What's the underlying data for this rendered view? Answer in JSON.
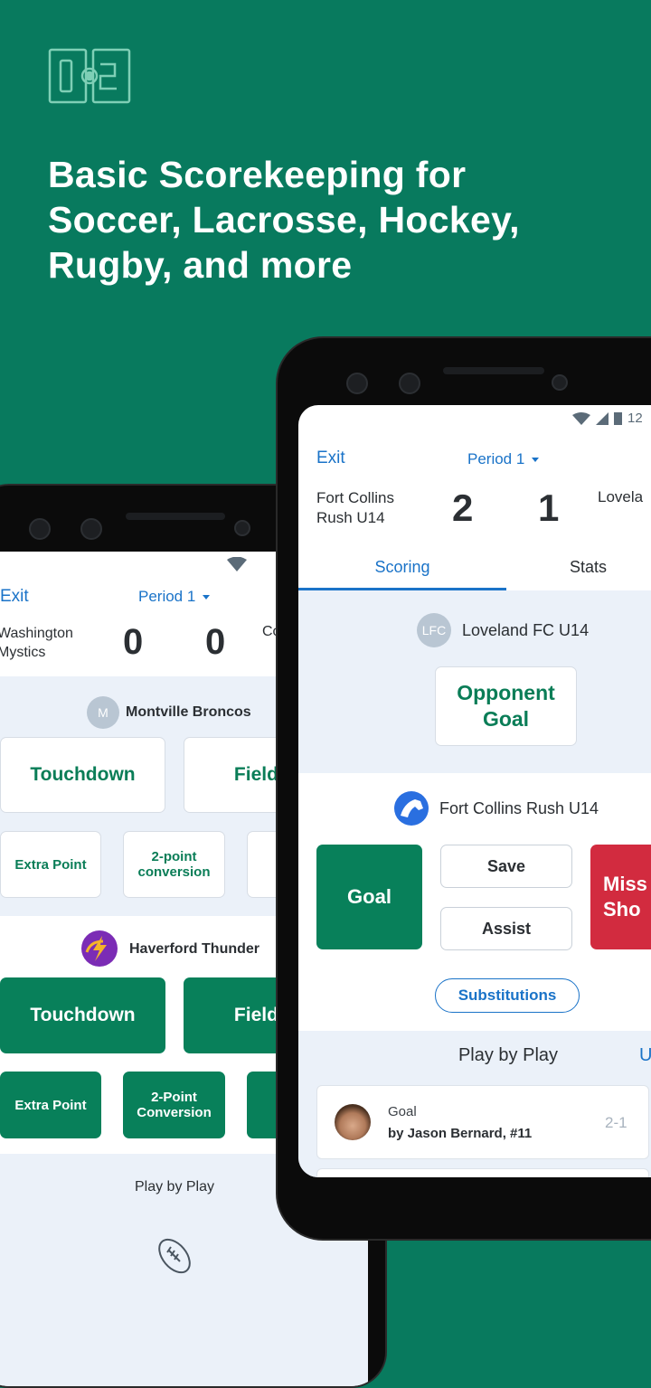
{
  "headline": [
    "Basic Scorekeeping for",
    "Soccer, Lacrosse, Hockey,",
    "Rugby, and more"
  ],
  "colors": {
    "background": "#087a5e",
    "accent_blue": "#1a73c8",
    "button_green": "#08805a",
    "missed_red": "#d22b3f",
    "light_bg": "#ebf1f9"
  },
  "back_phone": {
    "exit": "Exit",
    "period": "Period 1",
    "home_team": "Washington\nMystics",
    "home_score": "0",
    "away_score": "0",
    "away_team": "Co",
    "team1": {
      "avatar": "M",
      "name": "Montville Broncos",
      "buttons": [
        "Touchdown",
        "Field G",
        "Extra Point",
        "2-point conversion"
      ]
    },
    "team2": {
      "name": "Haverford Thunder",
      "buttons": [
        "Touchdown",
        "Field G",
        "Extra Point",
        "2-Point Conversion"
      ]
    },
    "play_by_play": "Play by Play",
    "empty_icon": "football-icon"
  },
  "front_phone": {
    "status_time": "12",
    "exit": "Exit",
    "period": "Period 1",
    "home_team": "Fort Collins\nRush U14",
    "home_score": "2",
    "away_score": "1",
    "away_team": "Lovela",
    "tabs": [
      {
        "label": "Scoring",
        "active": true
      },
      {
        "label": "Stats",
        "active": false
      }
    ],
    "opponent": {
      "avatar": "LFC",
      "name": "Loveland FC U14",
      "button": "Opponent Goal"
    },
    "team": {
      "name": "Fort Collins Rush U14",
      "goal": "Goal",
      "save": "Save",
      "assist": "Assist",
      "missed": "Miss\nSho",
      "substitutions": "Substitutions"
    },
    "play_by_play": {
      "title": "Play by Play",
      "action": "U",
      "items": [
        {
          "type": "Goal",
          "by": "by Jason Bernard, #11",
          "score": "2-1"
        }
      ]
    }
  }
}
